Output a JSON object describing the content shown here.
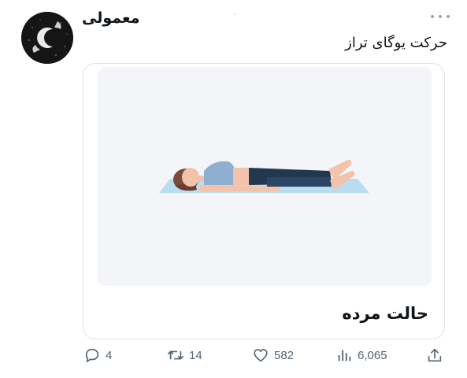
{
  "author": {
    "name": "معمولی"
  },
  "tweet": {
    "text": "حرکت یوگای تراز"
  },
  "card": {
    "title": "حالت مرده",
    "image_icon": "yoga-corpse-pose-illustration"
  },
  "actions": {
    "replies": "4",
    "retweets": "14",
    "likes": "582",
    "views": "6,065"
  },
  "icons": {
    "reply": "reply-icon",
    "retweet": "retweet-icon",
    "like": "heart-icon",
    "views": "views-icon",
    "share": "share-icon",
    "more": "more-icon"
  },
  "colors": {
    "muted": "#536471",
    "text": "#0f1419",
    "card_bg": "#f4f5f9",
    "mat": "#b9dcef"
  }
}
